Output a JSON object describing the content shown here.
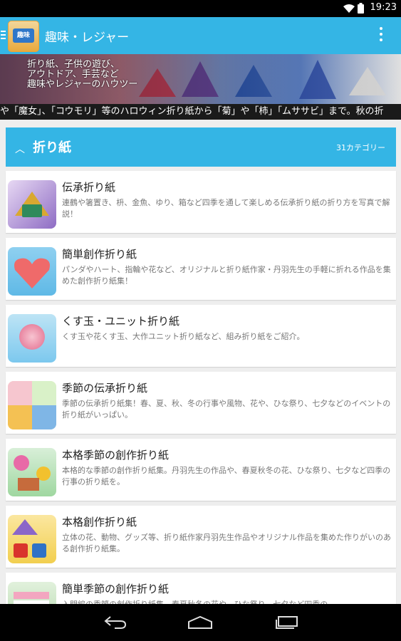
{
  "status_bar": {
    "time": "19:23"
  },
  "app_bar": {
    "logo_text": "趣味",
    "title": "趣味・レジャー"
  },
  "banner": {
    "lines": [
      "折り紙、子供の遊び、",
      "アウトドア、手芸など",
      "趣味やレジャーのハウツー"
    ]
  },
  "ticker": {
    "text": "や「魔女」、「コウモリ」等のハロウィン折り紙から「菊」や「柿」「ムササビ」まで。秋の折"
  },
  "section": {
    "title": "折り紙",
    "count": "31カテゴリー"
  },
  "items": [
    {
      "title": "伝承折り紙",
      "desc": "連鶴や箸置き、枡、金魚、ゆり、箱など四季を通して楽しめる伝承折り紙の折り方を写真で解説！"
    },
    {
      "title": "簡単創作折り紙",
      "desc": "パンダやハート、指輪や花など、オリジナルと折り紙作家・丹羽先生の手軽に折れる作品を集めた創作折り紙集！"
    },
    {
      "title": "くす玉・ユニット折り紙",
      "desc": "くす玉や花くす玉、大作ユニット折り紙など、組み折り紙をご紹介。"
    },
    {
      "title": "季節の伝承折り紙",
      "desc": "季節の伝承折り紙集！春、夏、秋、冬の行事や風物、花や、ひな祭り、七夕などのイベントの折り紙がいっぱい。"
    },
    {
      "title": "本格季節の創作折り紙",
      "desc": "本格的な季節の創作折り紙集。丹羽先生の作品や、春夏秋冬の花、ひな祭り、七夕など四季の行事の折り紙を。"
    },
    {
      "title": "本格創作折り紙",
      "desc": "立体の花、動物、グッズ等、折り紙作家丹羽先生作品やオリジナル作品を集めた作りがいのある創作折り紙集。"
    },
    {
      "title": "簡単季節の創作折り紙",
      "desc": "入門編の季節の創作折り紙集。春夏秋冬の花や、ひな祭り、七夕など四季の"
    }
  ],
  "icons": {
    "wifi": "wifi-icon",
    "battery": "battery-icon",
    "drawer": "hamburger-icon",
    "overflow": "overflow-icon",
    "back": "back-icon",
    "home": "home-icon",
    "recents": "recents-icon"
  },
  "colors": {
    "accent": "#34b5e5",
    "background": "#eeeeee"
  }
}
